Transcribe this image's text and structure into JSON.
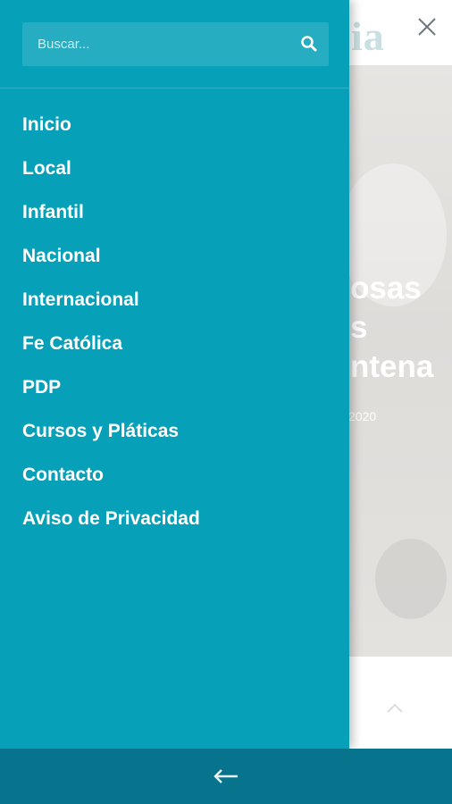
{
  "colors": {
    "drawer_background": "#06a1b9",
    "bottom_bar_background": "#07738d",
    "menu_text": "#ffffff"
  },
  "background_page": {
    "logo_fragment": "ia",
    "hero_title_lines": [
      "osas",
      "s",
      "ntena"
    ],
    "hero_date": "2020",
    "close_icon": "close-icon",
    "scroll_icon": "chevron-up-icon"
  },
  "drawer": {
    "search": {
      "placeholder": "Buscar...",
      "icon": "search-icon"
    },
    "menu_items": [
      {
        "label": "Inicio"
      },
      {
        "label": "Local"
      },
      {
        "label": "Infantil"
      },
      {
        "label": "Nacional"
      },
      {
        "label": "Internacional"
      },
      {
        "label": "Fe Católica"
      },
      {
        "label": "PDP"
      },
      {
        "label": "Cursos y Pláticas"
      },
      {
        "label": "Contacto"
      },
      {
        "label": "Aviso de Privacidad"
      }
    ]
  },
  "bottom_bar": {
    "back_icon": "arrow-left-icon"
  }
}
